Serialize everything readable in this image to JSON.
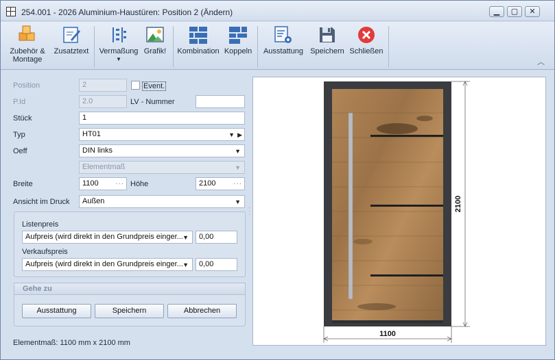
{
  "window": {
    "title": "254.001 - 2026 Aluminium-Haustüren: Position 2 (Ändern)"
  },
  "ribbon": {
    "buttons": {
      "zubehoer_line1": "Zubehör &",
      "zubehoer_line2": "Montage",
      "zusatztext": "Zusatztext",
      "vermassung": "Vermaßung",
      "grafik": "Grafik!",
      "kombination": "Kombination",
      "koppeln": "Koppeln",
      "ausstattung": "Ausstattung",
      "speichern": "Speichern",
      "schliessen": "Schließen"
    },
    "icons": {
      "zubehoer": "boxes-icon",
      "zusatztext": "edit-text-icon",
      "vermassung": "dimension-icon",
      "grafik": "picture-icon",
      "kombination": "grid-icon",
      "koppeln": "coupling-icon",
      "ausstattung": "settings-list-icon",
      "speichern": "save-icon",
      "schliessen": "close-icon"
    }
  },
  "form": {
    "position": {
      "label": "Position",
      "value": "2"
    },
    "event": {
      "label": "Event."
    },
    "pid": {
      "label": "P.Id",
      "value": "2.0"
    },
    "lv": {
      "label": "LV - Nummer",
      "value": ""
    },
    "stueck": {
      "label": "Stück",
      "value": "1"
    },
    "typ": {
      "label": "Typ",
      "value": "HT01"
    },
    "oeff": {
      "label": "Oeff",
      "value": "DIN links"
    },
    "elementmass": {
      "value": "Elementmaß"
    },
    "breite": {
      "label": "Breite",
      "value": "1100"
    },
    "hoehe": {
      "label": "Höhe",
      "value": "2100"
    },
    "ansicht": {
      "label": "Ansicht im Druck",
      "value": "Außen"
    },
    "listenpreis": {
      "label": "Listenpreis",
      "mode": "Aufpreis (wird direkt in den Grundpreis einger...",
      "value": "0,00"
    },
    "verkaufspreis": {
      "label": "Verkaufspreis",
      "mode": "Aufpreis (wird direkt in den Grundpreis einger...",
      "value": "0,00"
    },
    "goto": {
      "header": "Gehe zu",
      "ausstattung": "Ausstattung",
      "speichern": "Speichern",
      "abbrechen": "Abbrechen"
    }
  },
  "status": {
    "text": "Elementmaß: 1100 mm x 2100 mm"
  },
  "preview": {
    "width_label": "1100",
    "height_label": "2100"
  },
  "colors": {
    "frame": "#3a3c40",
    "wood": "#a87c4e",
    "accent_blue": "#3a6fb5",
    "close_red": "#e23b3b"
  }
}
